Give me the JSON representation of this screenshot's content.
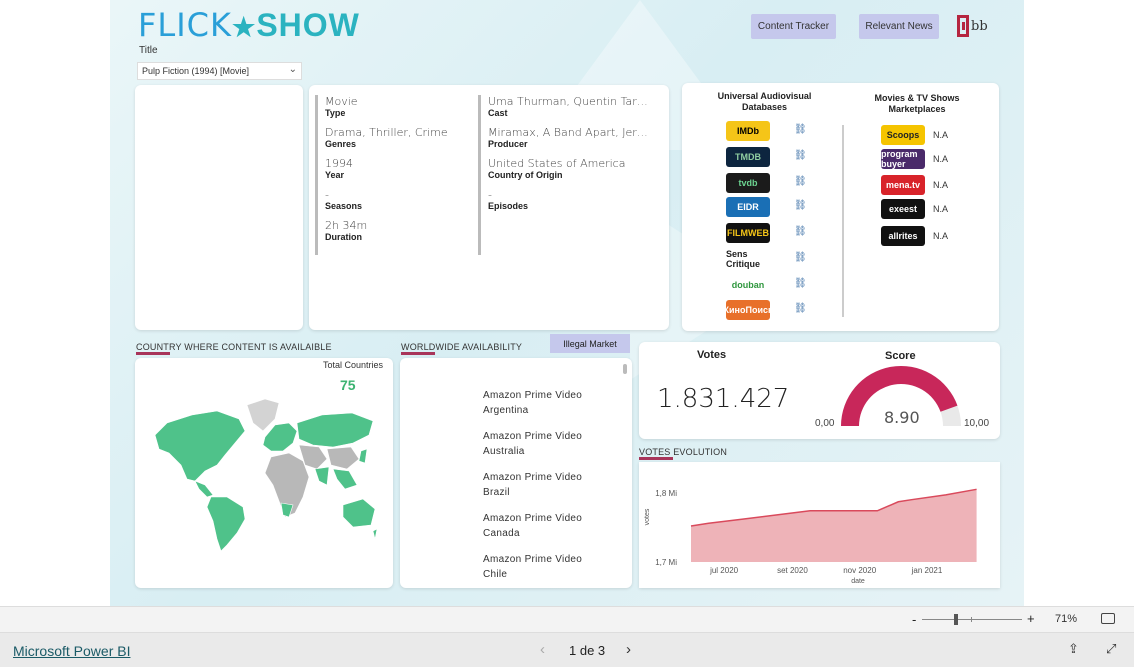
{
  "header": {
    "logo_left": "FLICK",
    "logo_right": "SHOW",
    "buttons": [
      "Content Tracker",
      "Relevant News"
    ],
    "brand_mark": "bb",
    "title_label": "Title",
    "title_value": "Pulp Fiction (1994) [Movie]"
  },
  "details": {
    "left": [
      {
        "value": "Movie",
        "label": "Type"
      },
      {
        "value": "Drama, Thriller, Crime",
        "label": "Genres"
      },
      {
        "value": "1994",
        "label": "Year"
      },
      {
        "value": "-",
        "label": "Seasons"
      },
      {
        "value": "2h 34m",
        "label": "Duration"
      }
    ],
    "right": [
      {
        "value": "Uma Thurman, Quentin Tara...",
        "label": "Cast"
      },
      {
        "value": "Miramax, A Band Apart, Jers...",
        "label": "Producer"
      },
      {
        "value": "United States of America",
        "label": "Country of Origin"
      },
      {
        "value": "-",
        "label": "Episodes"
      }
    ]
  },
  "databases": {
    "title": "Universal Audiovisual Databases",
    "items": [
      {
        "name": "IMDb",
        "color": "#f5c518",
        "text_color": "#000"
      },
      {
        "name": "TMDB",
        "color": "#0d253f",
        "text_color": "#90cea1"
      },
      {
        "name": "tvdb",
        "color": "#1b1b1b",
        "text_color": "#6cd491"
      },
      {
        "name": "EIDR",
        "color": "#1a6fb5",
        "text_color": "#ffffff"
      },
      {
        "name": "FILMWEB",
        "color": "#111111",
        "text_color": "#f5c518"
      },
      {
        "name": "Sens Critique",
        "color": "#ffffff",
        "text_color": "#222"
      },
      {
        "name": "douban",
        "color": "#ffffff",
        "text_color": "#2e963d"
      },
      {
        "name": "КиноПоиск",
        "color": "#e8702a",
        "text_color": "#ffffff"
      }
    ]
  },
  "marketplaces": {
    "title": "Movies & TV Shows Marketplaces",
    "items": [
      {
        "name": "Scoops",
        "color": "#f5c400",
        "text_color": "#222",
        "status": "N.A"
      },
      {
        "name": "program buyer",
        "color": "#4a2a6a",
        "text_color": "#ffffff",
        "status": "N.A"
      },
      {
        "name": "mena.tv",
        "color": "#d8232a",
        "text_color": "#ffffff",
        "status": "N.A"
      },
      {
        "name": "exeest",
        "color": "#111111",
        "text_color": "#ffffff",
        "status": "N.A"
      },
      {
        "name": "allrites",
        "color": "#111111",
        "text_color": "#ffffff",
        "status": "N.A"
      }
    ]
  },
  "countries": {
    "section_title": "COUNTRY WHERE CONTENT IS AVAILAIBLE",
    "total_label": "Total Countries",
    "total_value": "75"
  },
  "availability": {
    "section_title": "WORLDWIDE AVAILABILITY",
    "button": "Illegal Market",
    "items": [
      [
        "Amazon Prime Video",
        "Argentina"
      ],
      [
        "Amazon Prime Video",
        "Australia"
      ],
      [
        "Amazon Prime Video",
        "Brazil"
      ],
      [
        "Amazon Prime Video",
        "Canada"
      ],
      [
        "Amazon Prime Video",
        "Chile"
      ]
    ]
  },
  "votes": {
    "label": "Votes",
    "value": "1.831.427"
  },
  "score": {
    "label": "Score",
    "value": "8.90",
    "min_label": "0,00",
    "max_label": "10,00",
    "fraction": 0.89,
    "colors": {
      "fill": "#c8275a",
      "track": "#e9e9e9"
    }
  },
  "chart_data": {
    "type": "area",
    "title": "VOTES EVOLUTION",
    "xlabel": "date",
    "ylabel": "votes",
    "x": [
      "2020-06-15",
      "2020-07-01",
      "2020-08-01",
      "2020-09-01",
      "2020-10-01",
      "2020-11-01",
      "2020-12-01",
      "2020-12-20",
      "2021-01-01",
      "2021-02-01",
      "2021-03-01"
    ],
    "series": [
      {
        "values": [
          1752000,
          1756000,
          1762000,
          1768000,
          1774000,
          1774000,
          1774000,
          1787000,
          1790000,
          1797000,
          1805000
        ]
      }
    ],
    "x_ticks": [
      "jul 2020",
      "set 2020",
      "nov 2020",
      "jan 2021"
    ],
    "y_ticks": [
      "1,7 Mi",
      "1,8 Mi"
    ],
    "ylim": [
      1700000,
      1830000
    ],
    "colors": {
      "fill": "#eeb3b8",
      "line": "#d94a5c"
    }
  },
  "status": {
    "zoom_minus": "-",
    "zoom_plus": "+",
    "zoom_value": "71%"
  },
  "bottom": {
    "app_link": "Microsoft Power BI",
    "page_indicator": "1 de 3"
  }
}
